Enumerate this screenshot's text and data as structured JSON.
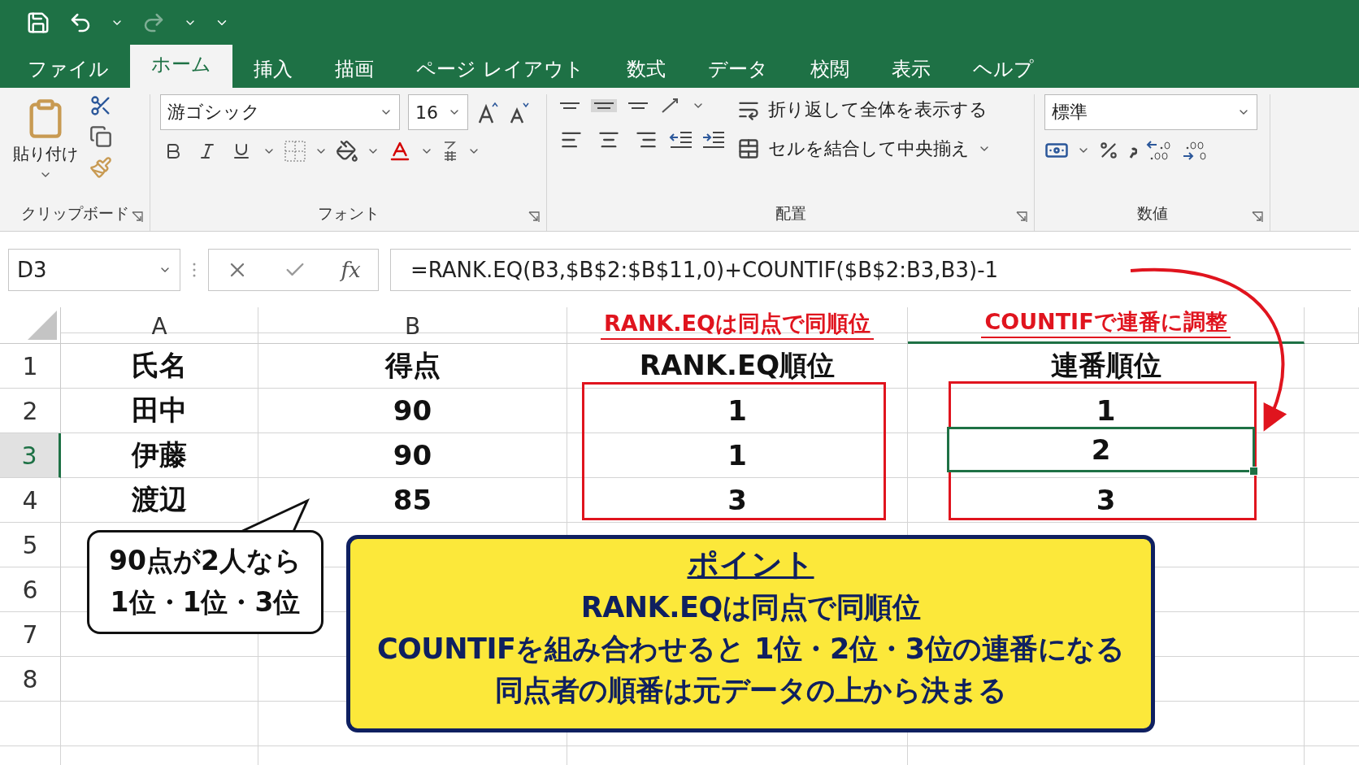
{
  "tabs": [
    {
      "label": "ファイル",
      "selected": false
    },
    {
      "label": "ホーム",
      "selected": true
    },
    {
      "label": "挿入",
      "selected": false
    },
    {
      "label": "描画",
      "selected": false
    },
    {
      "label": "ページ レイアウト",
      "selected": false
    },
    {
      "label": "数式",
      "selected": false
    },
    {
      "label": "データ",
      "selected": false
    },
    {
      "label": "校閲",
      "selected": false
    },
    {
      "label": "表示",
      "selected": false
    },
    {
      "label": "ヘルプ",
      "selected": false
    }
  ],
  "ribbon": {
    "clipboard": {
      "paste": "貼り付け",
      "label": "クリップボード"
    },
    "font": {
      "font_name": "游ゴシック",
      "font_size": "16",
      "label": "フォント"
    },
    "alignment": {
      "wrap_text": "折り返して全体を表示する",
      "merge_center": "セルを結合して中央揃え",
      "label": "配置"
    },
    "number": {
      "format": "標準",
      "label": "数値"
    }
  },
  "formula_bar": {
    "name_box": "D3",
    "fx": "fx",
    "formula": "=RANK.EQ(B3,$B$2:$B$11,0)+COUNTIF($B$2:B3,B3)-1"
  },
  "columns": [
    {
      "label": "A",
      "kind": "letter",
      "selected": false
    },
    {
      "label": "B",
      "kind": "letter",
      "selected": false
    },
    {
      "label": "RANK.EQは同点で同順位",
      "kind": "note",
      "selected": false
    },
    {
      "label": "COUNTIFで連番に調整",
      "kind": "note",
      "selected": true
    }
  ],
  "rows": [
    {
      "number": "1",
      "selected": false,
      "cells": [
        {
          "text": "氏名",
          "selected": false
        },
        {
          "text": "得点",
          "selected": false
        },
        {
          "text": "RANK.EQ順位",
          "selected": false
        },
        {
          "text": "連番順位",
          "selected": false
        }
      ]
    },
    {
      "number": "2",
      "selected": false,
      "cells": [
        {
          "text": "田中",
          "selected": false
        },
        {
          "text": "90",
          "selected": false
        },
        {
          "text": "1",
          "selected": false
        },
        {
          "text": "1",
          "selected": false
        }
      ]
    },
    {
      "number": "3",
      "selected": true,
      "cells": [
        {
          "text": "伊藤",
          "selected": false
        },
        {
          "text": "90",
          "selected": false
        },
        {
          "text": "1",
          "selected": false
        },
        {
          "text": "2",
          "selected": true
        }
      ]
    },
    {
      "number": "4",
      "selected": false,
      "cells": [
        {
          "text": "渡辺",
          "selected": false
        },
        {
          "text": "85",
          "selected": false
        },
        {
          "text": "3",
          "selected": false
        },
        {
          "text": "3",
          "selected": false
        }
      ]
    },
    {
      "number": "5",
      "selected": false
    },
    {
      "number": "6",
      "selected": false
    },
    {
      "number": "7",
      "selected": false
    },
    {
      "number": "8",
      "selected": false
    }
  ],
  "speech_bubble": {
    "lines": [
      "90点が2人なら",
      "1位・1位・3位"
    ]
  },
  "point_box": {
    "title": "ポイント",
    "lines": [
      "RANK.EQは同点で同順位",
      "COUNTIFを組み合わせると 1位・2位・3位の連番になる",
      "同点者の順番は元データの上から決まる"
    ]
  }
}
